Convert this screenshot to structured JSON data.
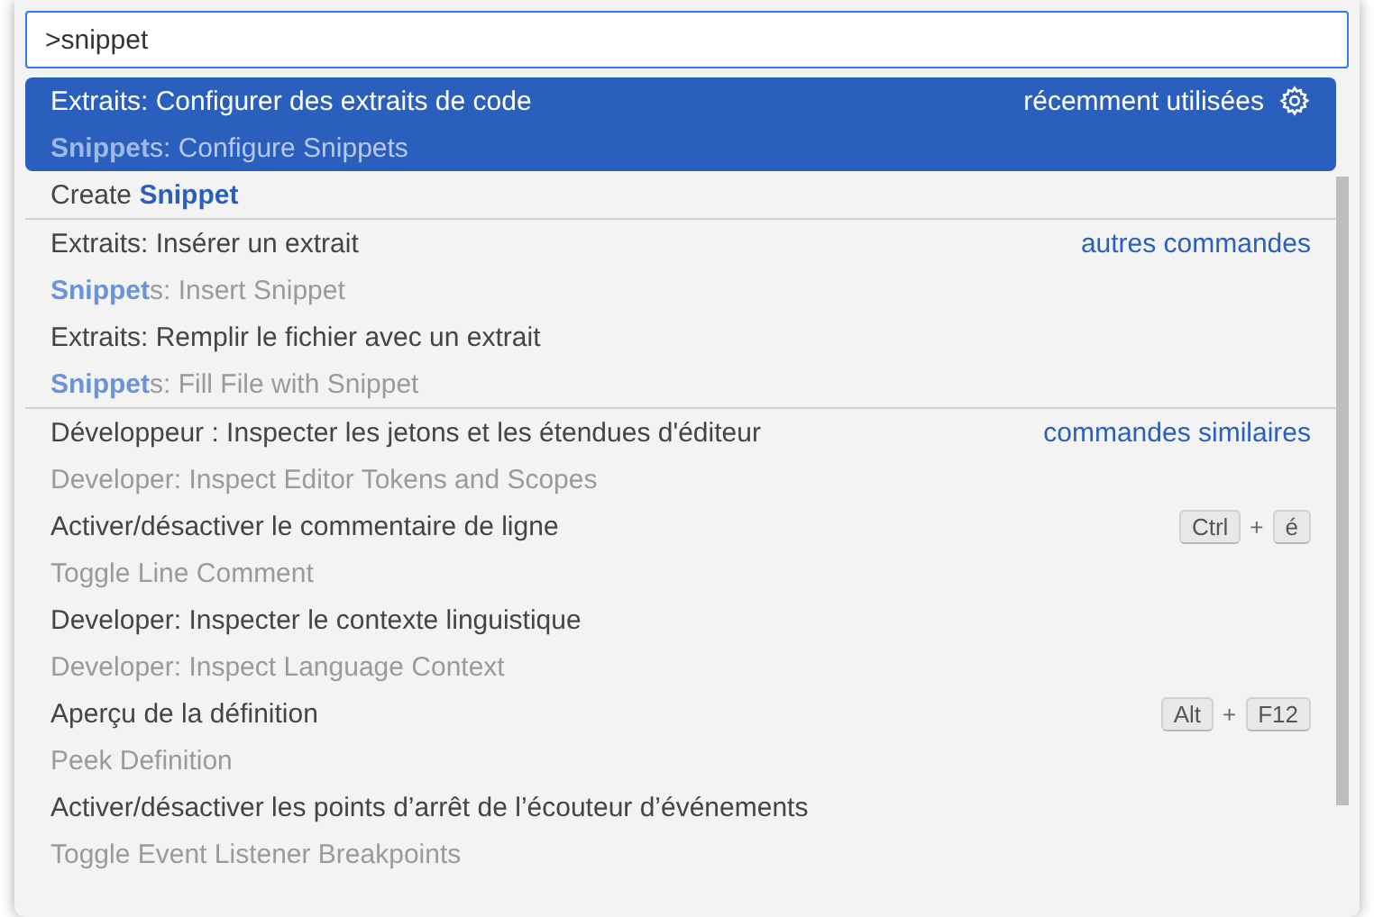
{
  "search": {
    "value": ">snippet"
  },
  "items": [
    {
      "label": "Extraits: Configurer des extraits de code",
      "detail": "**Snippet**s: Configure Snippets",
      "group": "récemment utilisées",
      "settings": true,
      "selected": true,
      "separator": false
    },
    {
      "label": "Create **Snippet**",
      "selected": false,
      "separator": false
    },
    {
      "label": "Extraits: Insérer un extrait",
      "detail": "**Snippet**s: Insert Snippet",
      "group": "autres commandes",
      "selected": false,
      "separator": true
    },
    {
      "label": "Extraits: Remplir le fichier avec un extrait",
      "detail": "**Snippet**s: Fill File with Snippet",
      "selected": false,
      "separator": false
    },
    {
      "label": "Développeur : Inspecter les jetons et les étendues d'éditeur",
      "detail": "Developer: Inspect Editor Tokens and Scopes",
      "group": "commandes similaires",
      "selected": false,
      "separator": true
    },
    {
      "label": "Activer/désactiver le commentaire de ligne",
      "detail": "Toggle Line Comment",
      "keys": [
        {
          "kind": "key",
          "text": "Ctrl"
        },
        {
          "kind": "plus",
          "text": "+"
        },
        {
          "kind": "key",
          "text": "é"
        }
      ],
      "selected": false,
      "separator": false
    },
    {
      "label": "Developer: Inspecter le contexte linguistique",
      "detail": "Developer: Inspect Language Context",
      "selected": false,
      "separator": false
    },
    {
      "label": "Aperçu de la définition",
      "detail": "Peek Definition",
      "keys": [
        {
          "kind": "key",
          "text": "Alt"
        },
        {
          "kind": "plus",
          "text": "+"
        },
        {
          "kind": "key",
          "text": "F12"
        }
      ],
      "selected": false,
      "separator": false
    },
    {
      "label": "Activer/désactiver les points d’arrêt de l’écouteur d’événements",
      "detail": "Toggle Event Listener Breakpoints",
      "selected": false,
      "separator": false
    }
  ]
}
